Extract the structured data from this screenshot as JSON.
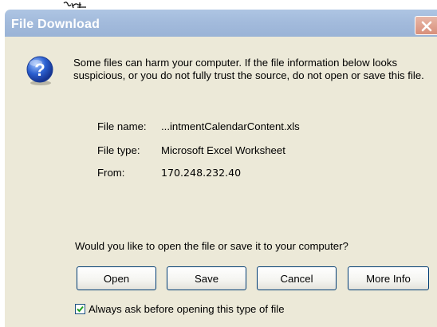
{
  "window": {
    "title": "File Download"
  },
  "message": "Some files can harm your computer. If the file information below looks suspicious, or you do not fully trust the source, do not open or save this file.",
  "file_info": {
    "name_label": "File name:",
    "name_value": "...intmentCalendarContent.xls",
    "type_label": "File type:",
    "type_value": "Microsoft Excel Worksheet",
    "from_label": "From:",
    "from_value": "170.248.232.40"
  },
  "prompt": "Would you like to open the file or save it to your computer?",
  "buttons": {
    "open": "Open",
    "save": "Save",
    "cancel": "Cancel",
    "more_info": "More Info"
  },
  "checkbox": {
    "label": "Always ask before opening this type of file",
    "checked": true
  },
  "colors": {
    "dialog_bg": "#ece9d8",
    "titlebar": "#a3bbdc",
    "close_button": "#d88f7a",
    "button_border": "#003c74"
  },
  "icons": {
    "question": "question-mark-icon",
    "close": "close-icon",
    "checkmark": "checkmark-icon"
  }
}
